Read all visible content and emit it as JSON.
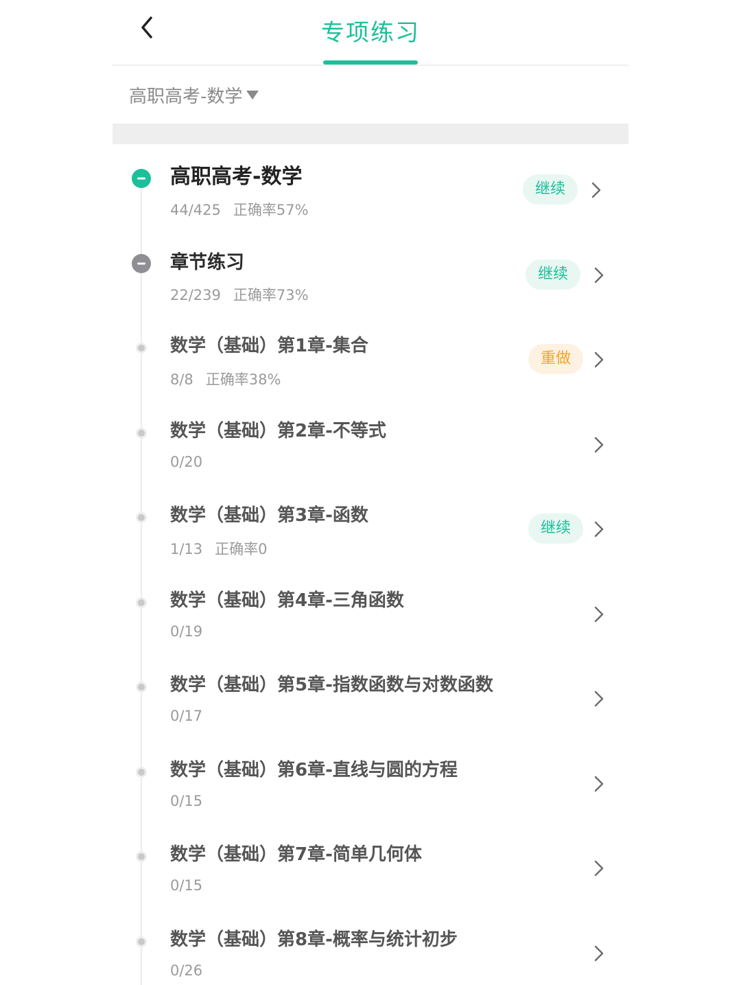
{
  "header": {
    "title": "专项练习"
  },
  "selector": {
    "label": "高职高考-数学"
  },
  "colors": {
    "accent": "#1dbf9a",
    "orange": "#f5a623",
    "text_secondary": "#9a9a9a"
  },
  "rows": [
    {
      "title": "高职高考-数学",
      "count": "44/425",
      "accuracy": "正确率57%",
      "action": "继续",
      "action_type": "continue",
      "node": "expanded-root"
    },
    {
      "title": "章节练习",
      "count": "22/239",
      "accuracy": "正确率73%",
      "action": "继续",
      "action_type": "continue",
      "node": "expanded"
    },
    {
      "title": "数学（基础）第1章-集合",
      "count": "8/8",
      "accuracy": "正确率38%",
      "action": "重做",
      "action_type": "redo",
      "node": "leaf"
    },
    {
      "title": "数学（基础）第2章-不等式",
      "count": "0/20",
      "accuracy": "",
      "action": "",
      "action_type": "none",
      "node": "leaf"
    },
    {
      "title": "数学（基础）第3章-函数",
      "count": "1/13",
      "accuracy": "正确率0",
      "action": "继续",
      "action_type": "continue",
      "node": "leaf"
    },
    {
      "title": "数学（基础）第4章-三角函数",
      "count": "0/19",
      "accuracy": "",
      "action": "",
      "action_type": "none",
      "node": "leaf"
    },
    {
      "title": "数学（基础）第5章-指数函数与对数函数",
      "count": "0/17",
      "accuracy": "",
      "action": "",
      "action_type": "none",
      "node": "leaf"
    },
    {
      "title": "数学（基础）第6章-直线与圆的方程",
      "count": "0/15",
      "accuracy": "",
      "action": "",
      "action_type": "none",
      "node": "leaf"
    },
    {
      "title": "数学（基础）第7章-简单几何体",
      "count": "0/15",
      "accuracy": "",
      "action": "",
      "action_type": "none",
      "node": "leaf"
    },
    {
      "title": "数学（基础）第8章-概率与统计初步",
      "count": "0/26",
      "accuracy": "",
      "action": "",
      "action_type": "none",
      "node": "leaf"
    }
  ],
  "icons": {
    "back": "chevron-left-icon",
    "dropdown": "caret-down-icon",
    "row_arrow": "chevron-right-icon",
    "collapse": "minus-circle-icon",
    "leaf": "dot-icon"
  }
}
